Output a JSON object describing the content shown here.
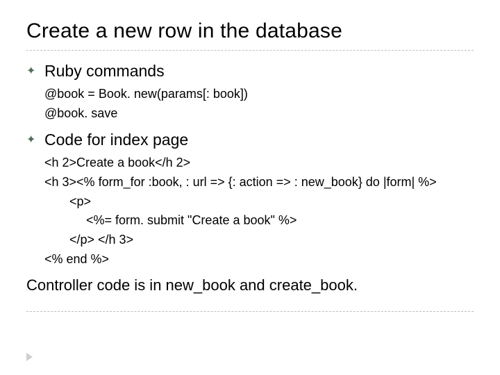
{
  "title": "Create a new row in the database",
  "items": [
    {
      "bullet": "✦",
      "heading": "Ruby commands",
      "lines": [
        {
          "text": "@book = Book. new(params[: book])",
          "indent": 0
        },
        {
          "text": "@book. save",
          "indent": 0
        }
      ]
    },
    {
      "bullet": "✦",
      "heading": "Code for index page",
      "lines": [
        {
          "text": "<h 2>Create a book</h 2>",
          "indent": 0
        },
        {
          "text": "<h 3><% form_for :book, : url => {: action => : new_book} do |form| %>",
          "indent": 0
        },
        {
          "text": "<p>",
          "indent": 1
        },
        {
          "text": "<%= form. submit \"Create a book\" %>",
          "indent": 2
        },
        {
          "text": "</p> </h 3>",
          "indent": 1
        },
        {
          "text": "<% end %>",
          "indent": 0
        }
      ]
    }
  ],
  "footer": "Controller code is in new_book and create_book."
}
